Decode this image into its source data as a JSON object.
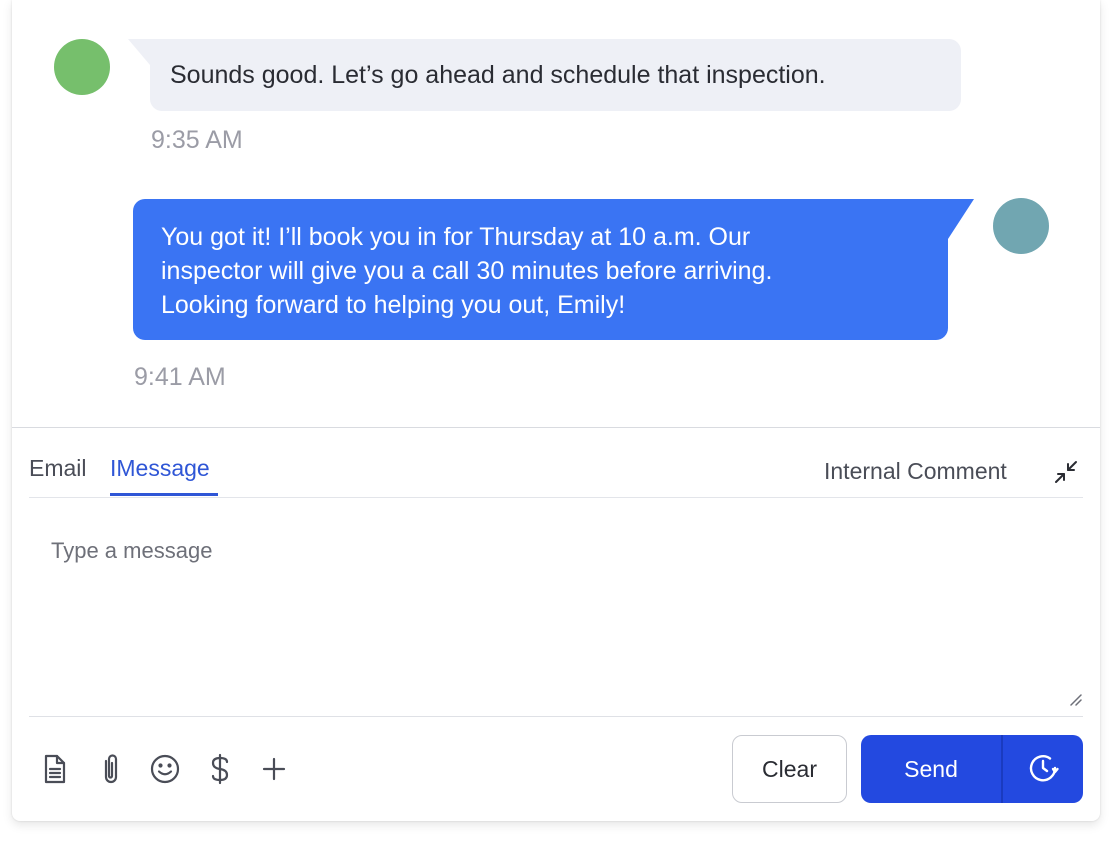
{
  "conversation": {
    "incoming": {
      "text": "Sounds good. Let’s go ahead and schedule that inspection.",
      "time": "9:35 AM",
      "avatar_color": "#76bf6c"
    },
    "outgoing": {
      "lines": [
        "You got it! I’ll book you in for Thursday at 10 a.m. Our",
        "inspector will give you a call 30 minutes before arriving.",
        "Looking forward to helping you out, Emily!"
      ],
      "time": "9:41 AM",
      "avatar_color": "#71a6b1",
      "bubble_color": "#3a74f3"
    }
  },
  "composer": {
    "tabs": {
      "email": "Email",
      "imessage": "IMessage",
      "internal_comment": "Internal Comment"
    },
    "active_tab": "IMessage",
    "placeholder": "Type a message",
    "value": "",
    "toolbar_icons": [
      "document-icon",
      "paperclip-icon",
      "emoji-icon",
      "dollar-icon",
      "plus-icon"
    ],
    "buttons": {
      "clear": "Clear",
      "send": "Send"
    },
    "accent_color": "#2349e0"
  }
}
